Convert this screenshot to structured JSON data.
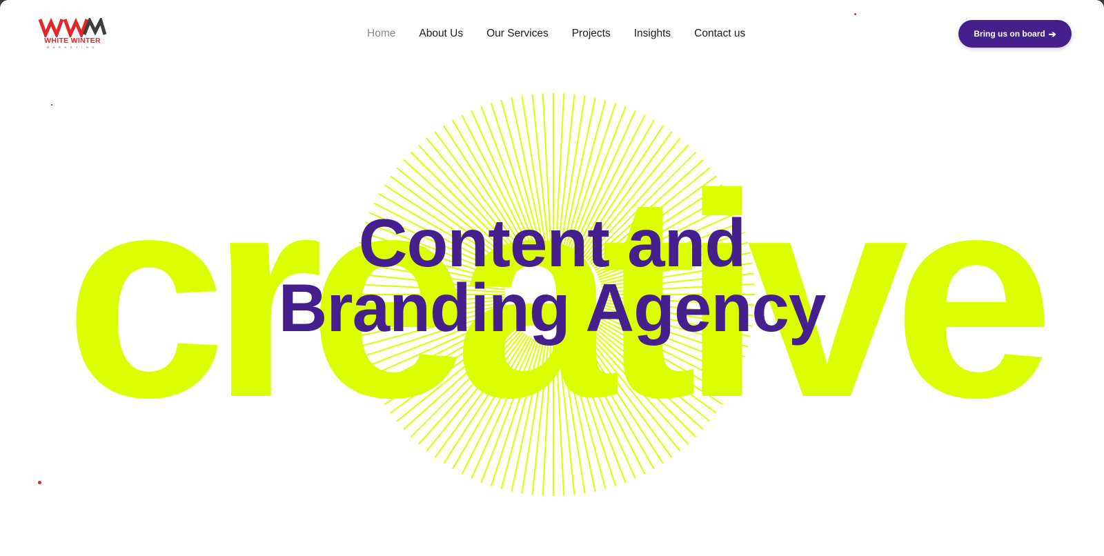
{
  "brand": {
    "name": "WHITE WINTER",
    "tagline": "MARKETING",
    "colors": {
      "primary": "#45208c",
      "accent": "#dcff00",
      "logo_red": "#e0272b",
      "logo_gray": "#3d3d3d"
    }
  },
  "nav": {
    "items": [
      {
        "label": "Home",
        "active": true
      },
      {
        "label": "About Us",
        "active": false
      },
      {
        "label": "Our Services",
        "active": false
      },
      {
        "label": "Projects",
        "active": false
      },
      {
        "label": "Insights",
        "active": false
      },
      {
        "label": "Contact us",
        "active": false
      }
    ]
  },
  "cta": {
    "label": "Bring us on board",
    "icon": "arrow-right-icon"
  },
  "hero": {
    "background_word": "creative",
    "headline_line1": "Content and",
    "headline_line2": "Branding Agency"
  }
}
